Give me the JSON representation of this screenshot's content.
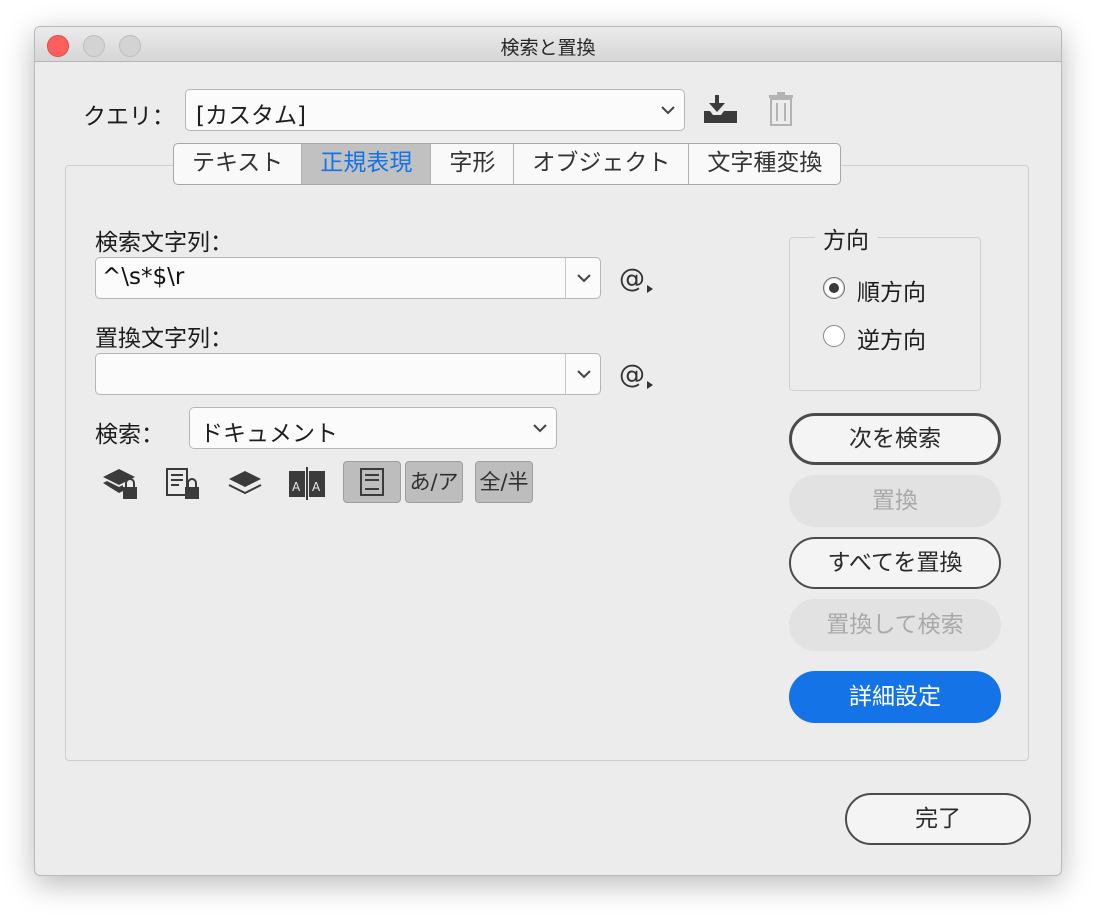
{
  "window": {
    "title": "検索と置換"
  },
  "query": {
    "label": "クエリ：",
    "value": "[カスタム]",
    "save_icon": "save-query-icon",
    "delete_icon": "trash-icon"
  },
  "tabs": [
    {
      "label": "テキスト",
      "active": false
    },
    {
      "label": "正規表現",
      "active": true
    },
    {
      "label": "字形",
      "active": false
    },
    {
      "label": "オブジェクト",
      "active": false
    },
    {
      "label": "文字種変換",
      "active": false
    }
  ],
  "find": {
    "label": "検索文字列：",
    "value": "^\\s*$\\r",
    "special_char_icon": "at-sign-menu-icon"
  },
  "replace": {
    "label": "置換文字列：",
    "value": "",
    "special_char_icon": "at-sign-menu-icon"
  },
  "search": {
    "label": "検索：",
    "value": "ドキュメント"
  },
  "options": {
    "toggle_kana": "あ/ア",
    "toggle_width": "全/半",
    "icons": [
      "locked-layers-icon",
      "locked-stories-icon",
      "hidden-layers-icon",
      "master-pages-icon",
      "footnotes-icon"
    ]
  },
  "direction": {
    "title": "方向",
    "forward": "順方向",
    "backward": "逆方向",
    "selected": "forward"
  },
  "buttons": {
    "find_next": "次を検索",
    "replace": "置換",
    "replace_all": "すべてを置換",
    "replace_find": "置換して検索",
    "more_options": "詳細設定",
    "done": "完了"
  },
  "colors": {
    "accent": "#1473e6",
    "close": "#fc605c"
  }
}
